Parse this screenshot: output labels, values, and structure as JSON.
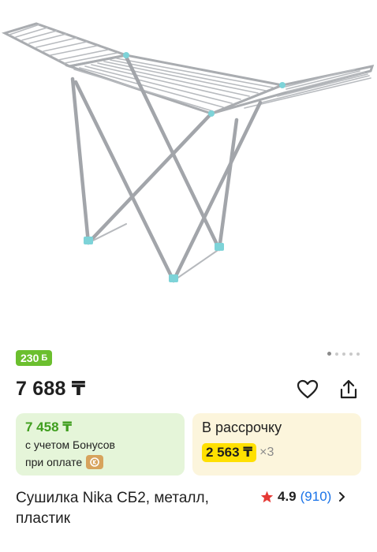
{
  "product": {
    "name": "Сушилка Nika СБ2, металл, пластик",
    "image_alt": "Сушилка для белья",
    "gallery": {
      "total_images": 5,
      "active_index": 0
    }
  },
  "bonus_badge": {
    "amount": "230",
    "symbol": "Б"
  },
  "price": {
    "current": "7 688 ₸"
  },
  "bonus_card": {
    "price": "7 458 ₸",
    "line1": "с учетом Бонусов",
    "line2": "при оплате"
  },
  "installment_card": {
    "title": "В рассрочку",
    "monthly": "2 563 ₸",
    "multiplier": "×3"
  },
  "rating": {
    "score": "4.9",
    "count": "(910)"
  },
  "icons": [
    "heart-icon",
    "share-icon",
    "star-icon",
    "chevron-right-icon",
    "kaspi-logo-icon"
  ],
  "colors": {
    "bonus_green": "#6bbf2e",
    "green_card_bg": "#e5f5d9",
    "green_text": "#3f9e1e",
    "yellow_card_bg": "#fcf5dc",
    "installment_highlight": "#ffe000",
    "rating_star": "#e53935",
    "link_blue": "#1a73e8",
    "rack_accent": "#7dd3d8"
  }
}
